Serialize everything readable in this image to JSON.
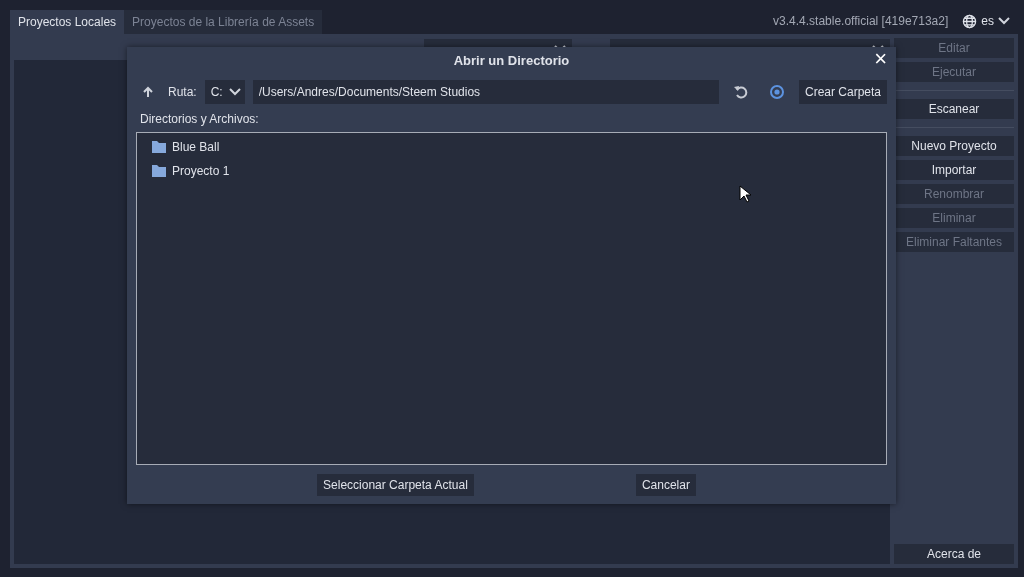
{
  "tabs": [
    {
      "label": "Proyectos Locales",
      "selected": true
    },
    {
      "label": "Proyectos de la Librería de Assets",
      "selected": false
    }
  ],
  "version": "v3.4.4.stable.official [419e713a2]",
  "language": {
    "value": "es"
  },
  "side_groups": [
    {
      "buttons": [
        {
          "label": "Editar",
          "disabled": true
        },
        {
          "label": "Ejecutar",
          "disabled": true
        }
      ]
    },
    {
      "buttons": [
        {
          "label": "Escanear",
          "disabled": false
        }
      ]
    },
    {
      "buttons": [
        {
          "label": "Nuevo Proyecto",
          "disabled": false
        },
        {
          "label": "Importar",
          "disabled": false
        },
        {
          "label": "Renombrar",
          "disabled": true
        },
        {
          "label": "Eliminar",
          "disabled": true
        },
        {
          "label": "Eliminar Faltantes",
          "disabled": true
        }
      ]
    }
  ],
  "about_button": "Acerca de",
  "dialog": {
    "title": "Abrir un Directorio",
    "close": "×",
    "path_label": "Ruta:",
    "drive": "C:",
    "path": "/Users/Andres/Documents/Steem Studios",
    "create_folder": "Crear Carpeta",
    "list_label": "Directorios y Archivos:",
    "items": [
      {
        "name": "Blue Ball",
        "selected": false
      },
      {
        "name": "Proyecto 1",
        "selected": false
      }
    ],
    "buttons": [
      "Seleccionar Carpeta Actual",
      "Cancelar"
    ]
  }
}
